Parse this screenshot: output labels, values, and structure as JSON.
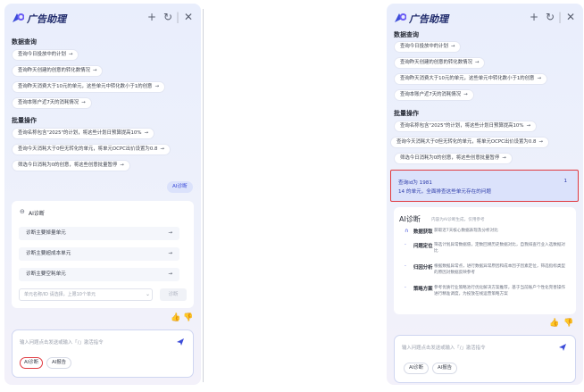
{
  "app": {
    "title": "广告助理",
    "header_icons": [
      "plus-icon",
      "history-icon",
      "divider",
      "close-icon"
    ],
    "plus": "+",
    "history": "↻",
    "sep": "|",
    "close": "✕"
  },
  "sections": {
    "data_query": "数据查询",
    "batch_ops": "批量操作"
  },
  "query_chips": [
    "查询今日投放中的计划",
    "查询昨天创建的创意的转化数情况",
    "查询昨天消费大于10元的单元，这些单元中转化数小于1的创意",
    "查询本账户近7天的消耗情况"
  ],
  "batch_chips": [
    "查询名称包含\"2025\"的计划，将这些计划日预算提高10%",
    "查询今天消耗大于0但无转化的单元，将单元OCPC出价设置为0.8",
    "筛选今日消耗为0的创意，将这些创意批量暂停"
  ],
  "arrow": "→",
  "ai_diag_pill": "AI诊断",
  "left_card": {
    "title": "AI诊断",
    "rows": [
      "诊断主要掉量单元",
      "诊断主要超成本单元",
      "诊断主要空耗单元"
    ],
    "unit_input_placeholder": "单元名称/ID  请选择，上限10个单元",
    "diagnose_btn": "诊断"
  },
  "feedback": {
    "like": "👍",
    "dislike": "👎"
  },
  "input": {
    "placeholder": "输入问题点击发送或输入「/」激活指令",
    "mode_ai_diag": "AI诊断",
    "mode_ai_report": "AI报告"
  },
  "right_highlight": {
    "line1": "查询id为 1981",
    "line1_tail": "1",
    "line2": "14 的单元，全面排查这些单元存在的问题"
  },
  "right_card": {
    "title": "AI诊断",
    "subtitle": "内容为AI诊断生成，仅用参考",
    "items": [
      {
        "title": "数据获取",
        "text": "获取近7天核心数据表现及分析对比"
      },
      {
        "title": "问题定位",
        "text": "筛选计划异常数据值，定数回溯历史数据对比，自我排查行业入选数据对比"
      },
      {
        "title": "归因分析",
        "text": "根据数据异常点，进行数据异常原因和成本因子因素定位，筛选指标类型的原因对数据反映参考"
      },
      {
        "title": "策略方案",
        "text": "参考优质行业策略池行优化解决方案推荐，基于当前账户个性化完善操作进行精准调度，为投放在线运营策略方案"
      }
    ]
  },
  "colors": {
    "accent": "#3b4bd8",
    "highlight_border": "#e0393f",
    "title": "#1f2a6b"
  }
}
